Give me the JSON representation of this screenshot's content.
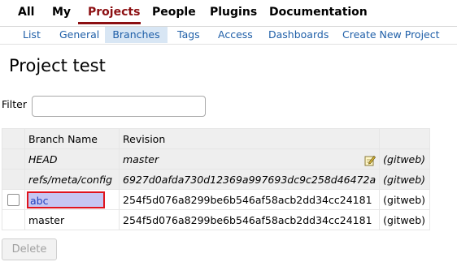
{
  "top_nav": [
    {
      "label": "All",
      "active": false
    },
    {
      "label": "My",
      "active": false
    },
    {
      "label": "Projects",
      "active": true
    },
    {
      "label": "People",
      "active": false
    },
    {
      "label": "Plugins",
      "active": false
    },
    {
      "label": "Documentation",
      "active": false
    }
  ],
  "sub_nav": [
    {
      "label": "List",
      "active": false
    },
    {
      "label": "General",
      "active": false
    },
    {
      "label": "Branches",
      "active": true
    },
    {
      "label": "Tags",
      "active": false
    },
    {
      "label": "Access",
      "active": false
    },
    {
      "label": "Dashboards",
      "active": false
    },
    {
      "label": "Create New Project",
      "active": false
    }
  ],
  "page_title": "Project test",
  "filter": {
    "label": "Filter",
    "value": "",
    "placeholder": ""
  },
  "table": {
    "headers": {
      "name": "Branch Name",
      "revision": "Revision"
    },
    "rows": [
      {
        "name": "HEAD",
        "revision": "master",
        "link": "(gitweb)",
        "special": true,
        "checkbox": false,
        "editable": true
      },
      {
        "name": "refs/meta/config",
        "revision": "6927d0afda730d12369a997693dc9c258d46472a",
        "link": "(gitweb)",
        "special": true,
        "checkbox": false,
        "editable": false
      },
      {
        "name": "abc",
        "revision": "254f5d076a8299be6b546af58acb2dd34cc24181",
        "link": "(gitweb)",
        "special": false,
        "checkbox": true,
        "highlighted": true
      },
      {
        "name": "master",
        "revision": "254f5d076a8299be6b546af58acb2dd34cc24181",
        "link": "(gitweb)",
        "special": false,
        "checkbox": false
      }
    ]
  },
  "delete_button": {
    "label": "Delete",
    "disabled": true
  },
  "colors": {
    "accent": "#8c0f12",
    "link": "#1f5fa8",
    "active_tab_bg": "#d8e6f4",
    "highlight_fill": "#c6c6f2",
    "highlight_border": "#e0141e"
  }
}
